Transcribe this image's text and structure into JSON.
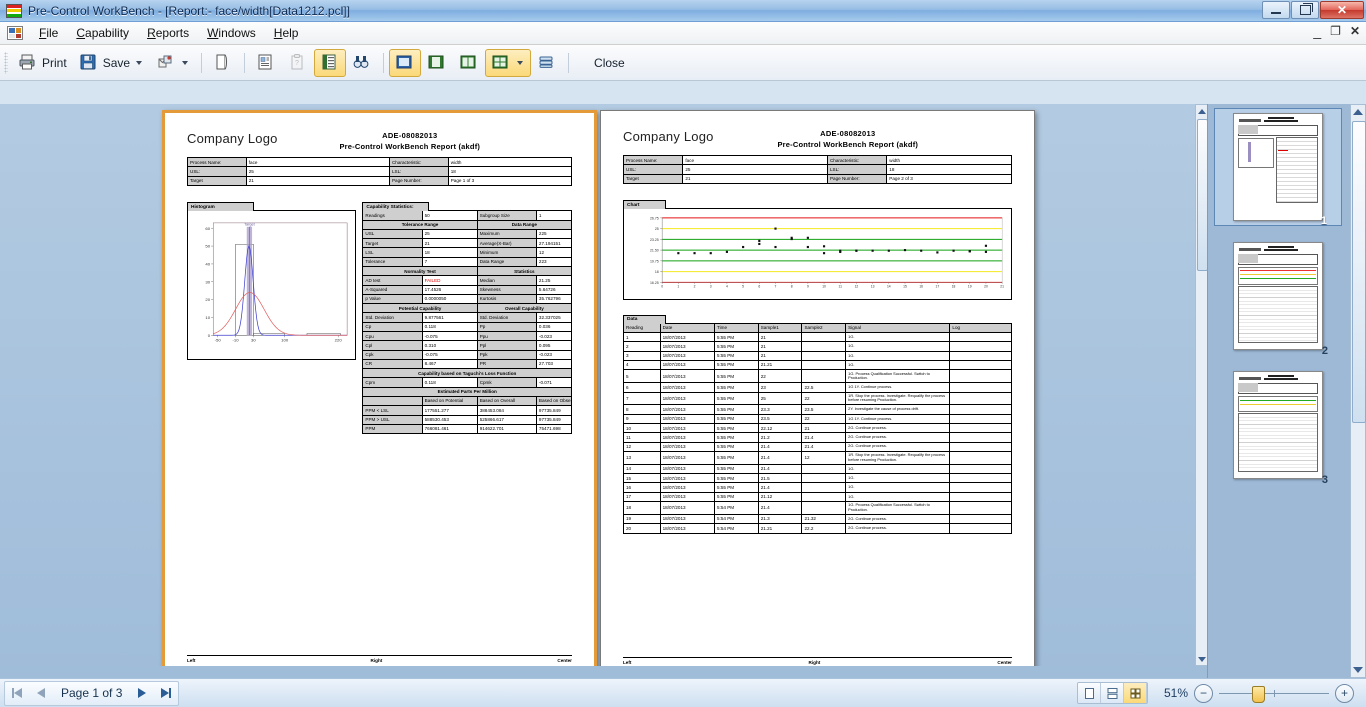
{
  "window": {
    "title": "Pre-Control WorkBench - [Report:- face/width[Data1212.pcl]]",
    "minimize": "–",
    "restore": "❐",
    "close": "✕"
  },
  "menu": {
    "items": [
      "File",
      "Capability",
      "Reports",
      "Windows",
      "Help"
    ],
    "mdi": {
      "minimize": "–",
      "restore": "❐",
      "close": "✕"
    }
  },
  "toolbar": {
    "print": "Print",
    "save": "Save",
    "close": "Close"
  },
  "report": {
    "logo": "Company Logo",
    "title_line1": "ADE-08082013",
    "title_line2": "Pre-Control WorkBench  Report (akdf)",
    "info": {
      "rows": [
        {
          "l1": "Process Name:",
          "v1": "face",
          "l2": "Characteristic:",
          "v2": "width"
        },
        {
          "l1": "USL:",
          "v1": "25",
          "l2": "LSL:",
          "v2": "18"
        },
        {
          "l1": "Target",
          "v1": "21",
          "l2": "Page Number:",
          "v2": "Page 1 of 3"
        }
      ]
    },
    "histogram_tab": "Histogram",
    "capability_tab": "Capability Statistics:",
    "chart_tab": "Chart",
    "data_tab": "Data",
    "cap": {
      "readings_label": "Readings",
      "readings_value": "50",
      "subgroup_label": "Subgroup Size",
      "subgroup_value": "1",
      "tol_range": "Tolerance Range",
      "data_range": "Data Range",
      "rows": [
        {
          "l1": "USL",
          "v1": "25",
          "l2": "Maximum",
          "v2": "225"
        },
        {
          "l1": "Target",
          "v1": "21",
          "l2": "Average(X-Bar)",
          "v2": "27.194151"
        },
        {
          "l1": "LSL",
          "v1": "18",
          "l2": "Minimum",
          "v2": "12"
        },
        {
          "l1": "Tolerance",
          "v1": "7",
          "l2": "Data Range",
          "v2": "223"
        }
      ],
      "normality_test": "Normality Test",
      "statistics": "Statistics",
      "norm_rows": [
        {
          "l1": "AD test",
          "v1": "FAILED",
          "v1_status": "failed",
          "l2": "Median",
          "v2": "21.25"
        },
        {
          "l1": "A-Squared",
          "v1": "17.4526",
          "l2": "Skewness",
          "v2": "5.64726"
        },
        {
          "l1": "p Value",
          "v1": "0.0000050",
          "l2": "Kurtosis",
          "v2": "35.762796"
        }
      ],
      "potential": "Potential Capability",
      "overall": "Overall Capability",
      "cap_rows": [
        {
          "l1": "Std. Deviation",
          "v1": "9.877561",
          "l2": "Std. Deviation",
          "v2": "32.337025"
        },
        {
          "l1": "Cp",
          "v1": "0.118",
          "l2": "Pp",
          "v2": "0.036"
        },
        {
          "l1": "Cpu",
          "v1": "-0.075",
          "l2": "Ppu",
          "v2": "-0.023"
        },
        {
          "l1": "Cpl",
          "v1": "0.310",
          "l2": "Ppl",
          "v2": "0.095"
        },
        {
          "l1": "Cpk",
          "v1": "-0.075",
          "l2": "Ppk",
          "v2": "-0.023"
        },
        {
          "l1": "CR",
          "v1": "8.467",
          "l2": "PR",
          "v2": "27.703"
        }
      ],
      "taguchi": "Capability based on Taguchi's Loss Function",
      "taguchi_rows": [
        {
          "l1": "Cpm",
          "v1": "0.118",
          "l2": "Cpmk",
          "v2": "-0.071"
        }
      ],
      "ppm_title": "Estimated Parts Per Million",
      "ppm_headers": [
        "",
        "Based on Potential",
        "Based on Overall",
        "Based on Observed"
      ],
      "ppm_rows": [
        {
          "l": "PPM < LSL",
          "a": "177551.277",
          "b": "388453.084",
          "c": "97735.849"
        },
        {
          "l": "PPM > USL",
          "a": "588530.453",
          "b": "525866.617",
          "c": "97735.849"
        },
        {
          "l": "PPM",
          "a": "766081.461",
          "b": "914622.701",
          "c": "75471.698"
        }
      ]
    },
    "footer": {
      "left": "Left",
      "center": "Right",
      "right": "Center"
    }
  },
  "report_page2": {
    "logo": "Company Logo",
    "title_line1": "ADE-08082013",
    "title_line2": "Pre-Control WorkBench  Report (akdf)",
    "info": {
      "rows": [
        {
          "l1": "Process Name:",
          "v1": "face",
          "l2": "Characteristic:",
          "v2": "width"
        },
        {
          "l1": "USL:",
          "v1": "25",
          "l2": "LSL:",
          "v2": "18"
        },
        {
          "l1": "Target",
          "v1": "21",
          "l2": "Page Number:",
          "v2": "Page 2 of 3"
        }
      ]
    },
    "data_headers": [
      "Reading",
      "Date",
      "Time",
      "Sample1",
      "Sample2",
      "Signal",
      "Log"
    ],
    "data_rows": [
      {
        "n": "1",
        "date": "18/07/2013",
        "time": "5:55 PM",
        "s1": "21",
        "s2": "",
        "signal": "1G.",
        "log": ""
      },
      {
        "n": "2",
        "date": "18/07/2013",
        "time": "5:55 PM",
        "s1": "21",
        "s2": "",
        "signal": "1G.",
        "log": ""
      },
      {
        "n": "3",
        "date": "18/07/2013",
        "time": "5:55 PM",
        "s1": "21",
        "s2": "",
        "signal": "1G.",
        "log": ""
      },
      {
        "n": "4",
        "date": "18/07/2013",
        "time": "5:55 PM",
        "s1": "21.21",
        "s2": "",
        "signal": "1G.",
        "log": ""
      },
      {
        "n": "5",
        "date": "18/07/2013",
        "time": "5:55 PM",
        "s1": "22",
        "s2": "",
        "signal": "1G. Process Qualification Successful. Switch to Production.",
        "log": ""
      },
      {
        "n": "6",
        "date": "18/07/2013",
        "time": "5:55 PM",
        "s1": "23",
        "s2": "22.5",
        "signal": "1G 1Y. Continue process.",
        "log": ""
      },
      {
        "n": "7",
        "date": "18/07/2013",
        "time": "5:55 PM",
        "s1": "25",
        "s2": "22",
        "signal": "1R. Stop the process. Investigate. Requalify the process before resuming Production.",
        "log": ""
      },
      {
        "n": "8",
        "date": "18/07/2013",
        "time": "5:55 PM",
        "s1": "23.3",
        "s2": "23.5",
        "signal": "2Y. Investigate the cause of process drift.",
        "log": ""
      },
      {
        "n": "9",
        "date": "18/07/2013",
        "time": "5:55 PM",
        "s1": "23.5",
        "s2": "22",
        "signal": "1G 1Y. Continue process.",
        "log": ""
      },
      {
        "n": "10",
        "date": "18/07/2013",
        "time": "5:55 PM",
        "s1": "22.12",
        "s2": "21",
        "signal": "2G. Continue process.",
        "log": ""
      },
      {
        "n": "11",
        "date": "18/07/2013",
        "time": "5:55 PM",
        "s1": "21.2",
        "s2": "21.4",
        "signal": "2G. Continue process.",
        "log": ""
      },
      {
        "n": "12",
        "date": "18/07/2013",
        "time": "5:55 PM",
        "s1": "21.4",
        "s2": "21.4",
        "signal": "2G. Continue process.",
        "log": ""
      },
      {
        "n": "13",
        "date": "18/07/2013",
        "time": "5:55 PM",
        "s1": "21.4",
        "s2": "12",
        "signal": "1R. Stop the process. Investigate. Requalify the process before resuming Production.",
        "log": ""
      },
      {
        "n": "14",
        "date": "18/07/2013",
        "time": "5:55 PM",
        "s1": "21.4",
        "s2": "",
        "signal": "1G.",
        "log": ""
      },
      {
        "n": "15",
        "date": "18/07/2013",
        "time": "5:55 PM",
        "s1": "21.5",
        "s2": "",
        "signal": "1G.",
        "log": ""
      },
      {
        "n": "16",
        "date": "18/07/2013",
        "time": "5:55 PM",
        "s1": "21.4",
        "s2": "",
        "signal": "1G.",
        "log": ""
      },
      {
        "n": "17",
        "date": "18/07/2013",
        "time": "5:55 PM",
        "s1": "21.12",
        "s2": "",
        "signal": "1G.",
        "log": ""
      },
      {
        "n": "18",
        "date": "18/07/2013",
        "time": "5:54 PM",
        "s1": "21.4",
        "s2": "",
        "signal": "1G. Process Qualification Successful. Switch to Production.",
        "log": ""
      },
      {
        "n": "19",
        "date": "18/07/2013",
        "time": "5:54 PM",
        "s1": "21.3",
        "s2": "21.32",
        "signal": "2G. Continue process.",
        "log": ""
      },
      {
        "n": "20",
        "date": "18/07/2013",
        "time": "5:54 PM",
        "s1": "21.21",
        "s2": "22.2",
        "signal": "2G. Continue process.",
        "log": ""
      }
    ],
    "footer": {
      "left": "Left",
      "center": "Right",
      "right": "Center"
    }
  },
  "chart_data": [
    {
      "type": "bar",
      "title": "Histogram",
      "xlabel": "",
      "ylabel": "",
      "categories": [
        "-50",
        "-10",
        "30",
        "100",
        "220"
      ],
      "xticks": [
        "-50",
        "-10",
        "30",
        "100",
        "220"
      ],
      "yticks": [
        "0",
        "10",
        "20",
        "30",
        "40",
        "50",
        "60"
      ],
      "ylim": [
        0,
        63
      ],
      "xlim": [
        -60,
        240
      ],
      "values": [
        0,
        51,
        1,
        1,
        1
      ],
      "bins": [
        {
          "x0": -10,
          "x1": 30,
          "count": 51
        },
        {
          "x0": 30,
          "x1": 100,
          "count": 1
        },
        {
          "x0": 150,
          "x1": 225,
          "count": 1
        }
      ],
      "annotations": [
        {
          "label": "Target",
          "x": 21,
          "color": "#8f7fc0"
        }
      ],
      "series": [
        {
          "name": "within-curve",
          "color": "#4040d0",
          "peak": 50
        },
        {
          "name": "overall-curve",
          "color": "#e06060",
          "peak": 24
        }
      ],
      "grid": false,
      "legend": "none"
    },
    {
      "type": "scatter",
      "title": "Chart",
      "xlabel": "",
      "ylabel": "",
      "xticks": [
        "0",
        "1",
        "2",
        "3",
        "4",
        "5",
        "6",
        "7",
        "8",
        "9",
        "10",
        "11",
        "12",
        "13",
        "14",
        "15",
        "16",
        "17",
        "18",
        "19",
        "20",
        "21"
      ],
      "yticks": [
        "16.25",
        "18",
        "19.75",
        "21.5",
        "23.25",
        "25",
        "26.75"
      ],
      "ylim": [
        16.25,
        26.75
      ],
      "xlim": [
        0,
        21
      ],
      "reference_lines": [
        {
          "value": 26.75,
          "color": "#e81414",
          "name": "upper-red"
        },
        {
          "value": 25.0,
          "color": "#f2e81e",
          "name": "upper-yellow"
        },
        {
          "value": 23.25,
          "color": "#12a012",
          "name": "upper-green"
        },
        {
          "value": 21.5,
          "color": "#12a012",
          "name": "center-green"
        },
        {
          "value": 19.75,
          "color": "#12a012",
          "name": "lower-green"
        },
        {
          "value": 18.0,
          "color": "#f2e81e",
          "name": "lower-yellow"
        },
        {
          "value": 16.25,
          "color": "#e81414",
          "name": "lower-red"
        }
      ],
      "points": [
        {
          "x": 1,
          "y": 21.0
        },
        {
          "x": 2,
          "y": 21.0
        },
        {
          "x": 3,
          "y": 21.0
        },
        {
          "x": 4,
          "y": 21.21
        },
        {
          "x": 5,
          "y": 22.0
        },
        {
          "x": 6,
          "y": 23.0
        },
        {
          "x": 6,
          "y": 22.5
        },
        {
          "x": 7,
          "y": 25.0
        },
        {
          "x": 7,
          "y": 22.0
        },
        {
          "x": 8,
          "y": 23.3
        },
        {
          "x": 8,
          "y": 23.5
        },
        {
          "x": 9,
          "y": 23.5
        },
        {
          "x": 9,
          "y": 22.0
        },
        {
          "x": 10,
          "y": 22.12
        },
        {
          "x": 10,
          "y": 21.0
        },
        {
          "x": 11,
          "y": 21.2
        },
        {
          "x": 11,
          "y": 21.4
        },
        {
          "x": 12,
          "y": 21.4
        },
        {
          "x": 12,
          "y": 21.4
        },
        {
          "x": 13,
          "y": 21.4
        },
        {
          "x": 14,
          "y": 21.4
        },
        {
          "x": 15,
          "y": 21.5
        },
        {
          "x": 16,
          "y": 21.4
        },
        {
          "x": 17,
          "y": 21.12
        },
        {
          "x": 18,
          "y": 21.4
        },
        {
          "x": 19,
          "y": 21.3
        },
        {
          "x": 19,
          "y": 21.32
        },
        {
          "x": 20,
          "y": 21.21
        },
        {
          "x": 20,
          "y": 22.2
        }
      ],
      "grid": false,
      "legend": "none"
    }
  ],
  "thumbnails": [
    {
      "num": "1",
      "selected": true
    },
    {
      "num": "2",
      "selected": false
    },
    {
      "num": "3",
      "selected": false
    }
  ],
  "status": {
    "page_label": "Page 1 of 3",
    "zoom": "51%",
    "first": "⏮",
    "prev": "◀",
    "next": "▶",
    "last": "⏭",
    "zoom_out": "−",
    "zoom_in": "+"
  }
}
